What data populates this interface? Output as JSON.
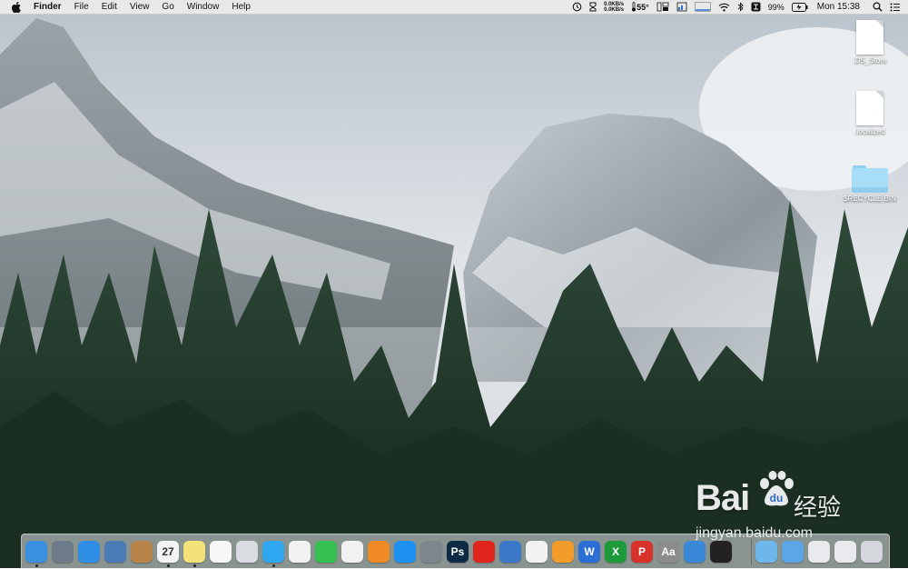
{
  "menubar": {
    "apple_icon": "apple-logo-icon",
    "app_name": "Finder",
    "menus": [
      "File",
      "Edit",
      "View",
      "Go",
      "Window",
      "Help"
    ],
    "status": {
      "net_up": "0.0KB/s",
      "net_down": "0.0KB/s",
      "temperature": "55°",
      "battery_percent": "99%",
      "clock": "Mon 15:38"
    }
  },
  "desktop_icons": [
    {
      "label": ".DS_Store",
      "type": "document"
    },
    {
      "label": ".localized",
      "type": "document"
    },
    {
      "label": "$RECYCLE.BIN",
      "type": "folder"
    }
  ],
  "dock": {
    "apps": [
      {
        "name": "finder-icon",
        "color": "#3b8fe0"
      },
      {
        "name": "launchpad-icon",
        "color": "#6d7a89"
      },
      {
        "name": "safari-icon",
        "color": "#2f8de4"
      },
      {
        "name": "preview-icon",
        "color": "#4a7bb5"
      },
      {
        "name": "contacts-icon",
        "color": "#b8844a"
      },
      {
        "name": "calendar-icon",
        "color": "#f4f4f4",
        "text": "27"
      },
      {
        "name": "notes-icon",
        "color": "#f3e27a"
      },
      {
        "name": "reminders-icon",
        "color": "#f7f7f7"
      },
      {
        "name": "photo-booth-icon",
        "color": "#d9dde2"
      },
      {
        "name": "messages-icon",
        "color": "#2fa6f0"
      },
      {
        "name": "photos-icon",
        "color": "#f2f2f2"
      },
      {
        "name": "facetime-icon",
        "color": "#35c14f"
      },
      {
        "name": "itunes-icon",
        "color": "#f2f2f2"
      },
      {
        "name": "ibooks-icon",
        "color": "#f08a24"
      },
      {
        "name": "app-store-icon",
        "color": "#1e90f0"
      },
      {
        "name": "system-preferences-icon",
        "color": "#7f858c"
      },
      {
        "name": "photoshop-icon",
        "color": "#0f2a44",
        "text": "Ps"
      },
      {
        "name": "netease-music-icon",
        "color": "#e0251f"
      },
      {
        "name": "keynote-icon",
        "color": "#3c78c8"
      },
      {
        "name": "numbers-icon",
        "color": "#f2f2f2"
      },
      {
        "name": "pages-icon",
        "color": "#f29a2a"
      },
      {
        "name": "wps-writer-icon",
        "color": "#2b6fd6",
        "text": "W"
      },
      {
        "name": "wps-spreadsheet-icon",
        "color": "#1f9a3a",
        "text": "X"
      },
      {
        "name": "wps-presentation-icon",
        "color": "#d9322b",
        "text": "P"
      },
      {
        "name": "dictionary-icon",
        "color": "#8c8c8c",
        "text": "Aa"
      },
      {
        "name": "disk-utility-icon",
        "color": "#3a88d8"
      },
      {
        "name": "qq-icon",
        "color": "#222222"
      }
    ],
    "stacks": [
      {
        "name": "applications-folder-icon",
        "color": "#6fb7ea"
      },
      {
        "name": "downloads-folder-icon",
        "color": "#5aa6e6"
      },
      {
        "name": "documents-stack-icon",
        "color": "#e8eaed"
      },
      {
        "name": "screenshot-stack-icon",
        "color": "#e8eaed"
      },
      {
        "name": "trash-icon",
        "color": "#d4d8dc"
      }
    ]
  },
  "watermark": {
    "brand": "Bai",
    "brand_suffix": "经验",
    "url": "jingyan.baidu.com"
  }
}
